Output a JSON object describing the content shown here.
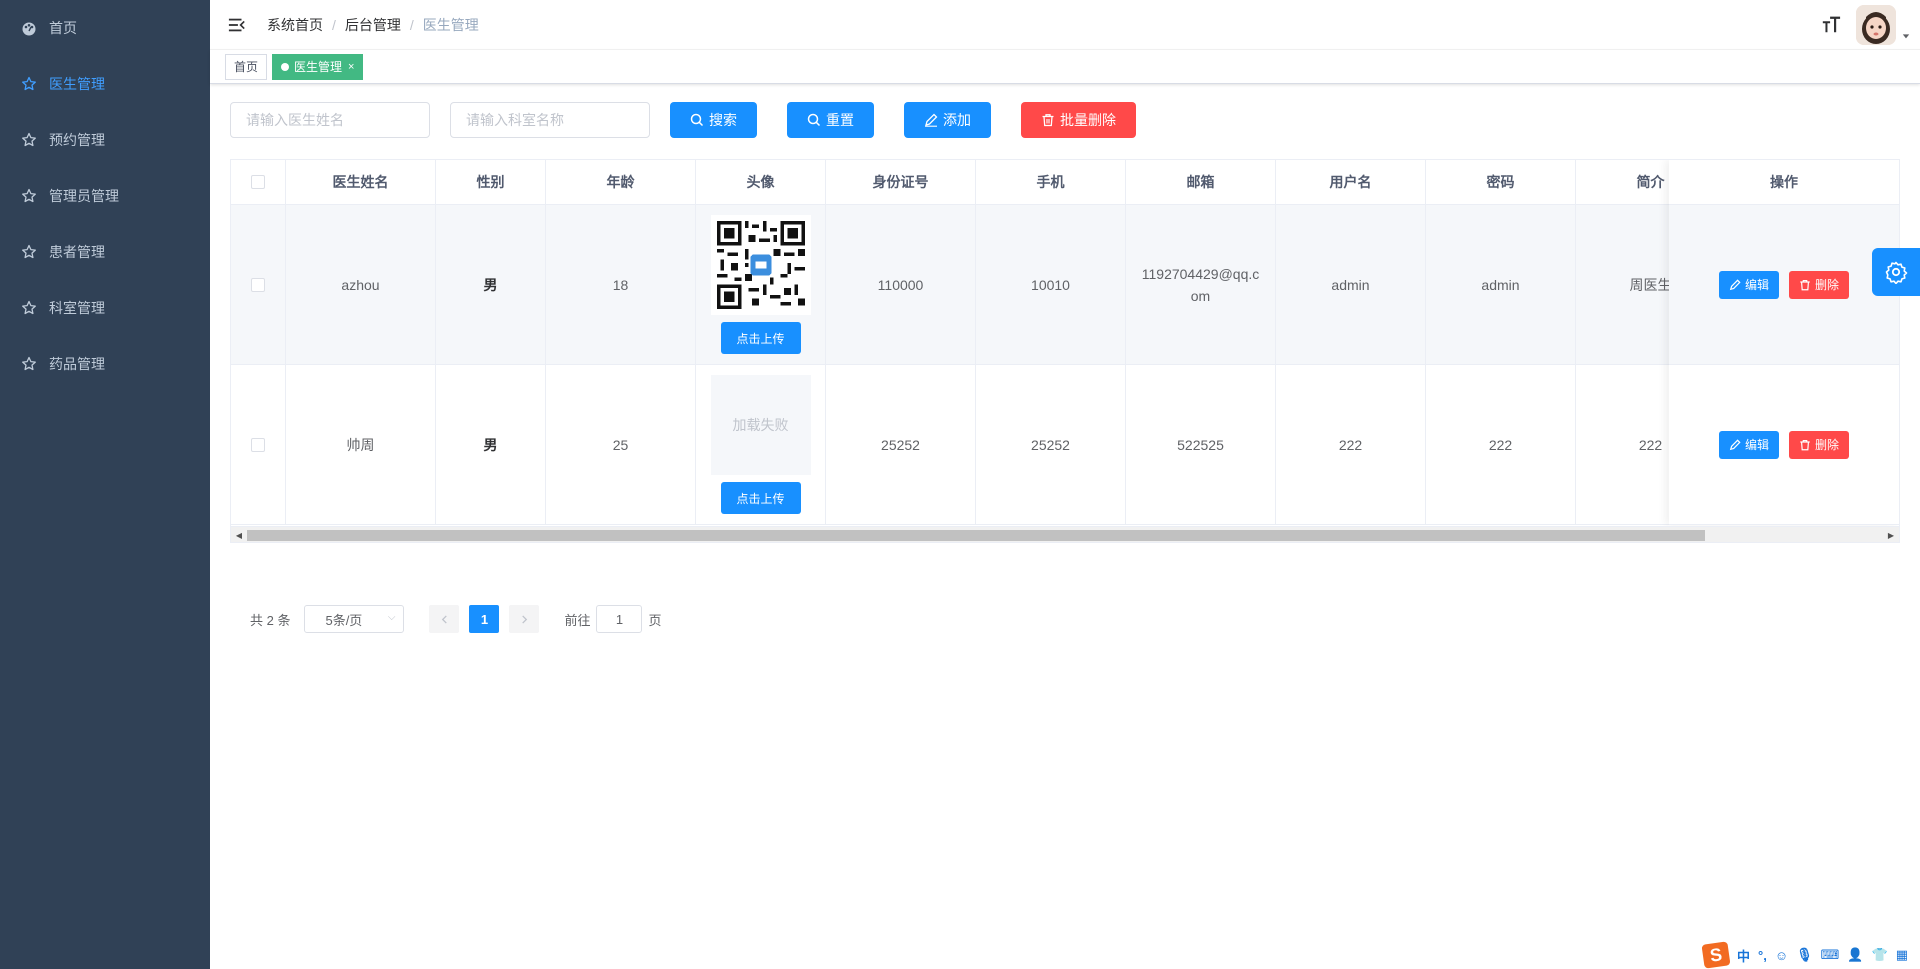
{
  "sidebar": {
    "items": [
      {
        "label": "首页",
        "icon": "dashboard-icon",
        "active": false
      },
      {
        "label": "医生管理",
        "icon": "star-icon",
        "active": true
      },
      {
        "label": "预约管理",
        "icon": "star-icon",
        "active": false
      },
      {
        "label": "管理员管理",
        "icon": "star-icon",
        "active": false
      },
      {
        "label": "患者管理",
        "icon": "star-icon",
        "active": false
      },
      {
        "label": "科室管理",
        "icon": "star-icon",
        "active": false
      },
      {
        "label": "药品管理",
        "icon": "star-icon",
        "active": false
      }
    ]
  },
  "breadcrumb": [
    "系统首页",
    "后台管理",
    "医生管理"
  ],
  "tags": [
    {
      "label": "首页",
      "active": false
    },
    {
      "label": "医生管理",
      "active": true,
      "close": "×"
    }
  ],
  "search": {
    "doctor_name_placeholder": "请输入医生姓名",
    "department_placeholder": "请输入科室名称",
    "search_label": "搜索",
    "reset_label": "重置",
    "add_label": "添加",
    "batch_delete_label": "批量删除"
  },
  "table": {
    "columns": [
      "医生姓名",
      "性别",
      "年龄",
      "头像",
      "身份证号",
      "手机",
      "邮箱",
      "用户名",
      "密码",
      "简介",
      "操作"
    ],
    "rows": [
      {
        "name": "azhou",
        "gender": "男",
        "age": "18",
        "avatar": "qr",
        "id_no": "110000",
        "phone": "10010",
        "email": "1192704429@qq.com",
        "username": "admin",
        "password": "admin",
        "intro": "周医生"
      },
      {
        "name": "帅周",
        "gender": "男",
        "age": "25",
        "avatar": "failed",
        "avatar_failed_text": "加载失败",
        "id_no": "25252",
        "phone": "25252",
        "email": "522525",
        "username": "222",
        "password": "222",
        "intro": "222"
      }
    ],
    "upload_label": "点击上传",
    "edit_label": "编辑",
    "delete_label": "删除"
  },
  "pagination": {
    "total_text": "共 2 条",
    "page_size": "5条/页",
    "current_page": "1",
    "goto_label": "前往",
    "goto_value": "1",
    "page_suffix": "页"
  },
  "ime": {
    "lang": "中"
  },
  "colors": {
    "primary": "#1890ff",
    "danger": "#ff4949",
    "sidebar_bg": "#304156",
    "tag_active": "#42b983"
  }
}
